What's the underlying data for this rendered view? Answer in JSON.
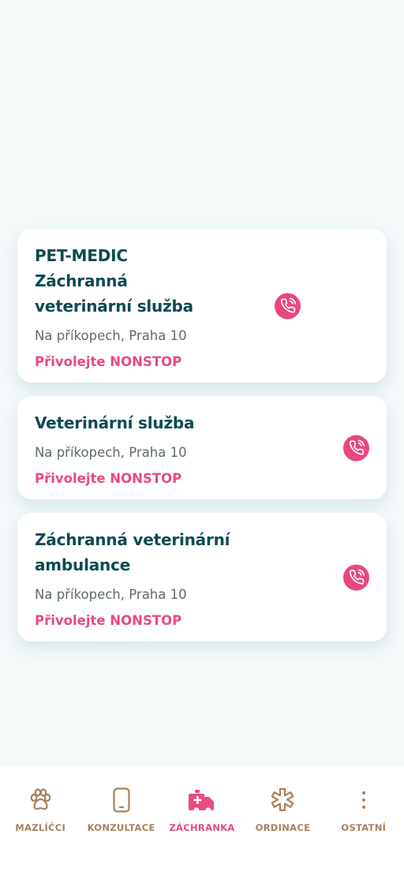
{
  "cards": [
    {
      "title": "PET-MEDIC Záchranná veterinární služba",
      "address": "Na příkopech, Praha 10",
      "cta": "Přivolejte NONSTOP",
      "icon": "phone-call-icon"
    },
    {
      "title": "Veterinární služba",
      "address": "Na příkopech, Praha 10",
      "cta": "Přivolejte NONSTOP",
      "icon": "phone-call-icon"
    },
    {
      "title": "Záchranná veterinární ambulance",
      "address": "Na příkopech, Praha 10",
      "cta": "Přivolejte NONSTOP",
      "icon": "phone-call-icon"
    }
  ],
  "nav": {
    "items": [
      {
        "label": "MAZLÍČCI",
        "icon": "paw-icon",
        "active": false
      },
      {
        "label": "KONZULTACE",
        "icon": "smartphone-icon",
        "active": false
      },
      {
        "label": "ZÁCHRANKA",
        "icon": "ambulance-icon",
        "active": true
      },
      {
        "label": "ORDINACE",
        "icon": "medical-cross-icon",
        "active": false
      },
      {
        "label": "OSTATNÍ",
        "icon": "more-vertical-icon",
        "active": false
      }
    ]
  },
  "colors": {
    "background": "#f4f9fa",
    "title": "#0d4a52",
    "accent": "#e84a83",
    "nav_inactive": "#a8815c",
    "text_secondary": "#5f6b6e"
  }
}
